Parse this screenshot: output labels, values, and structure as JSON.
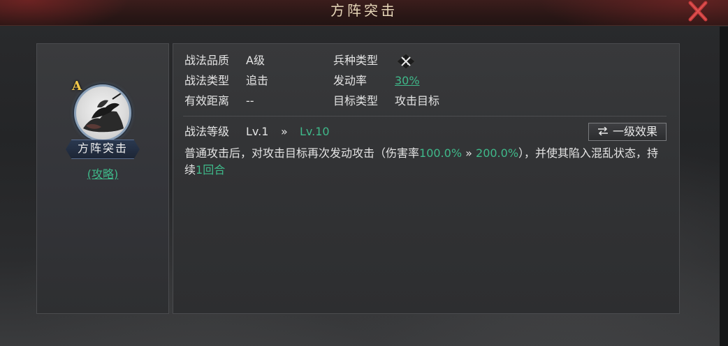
{
  "window": {
    "title": "方阵突击"
  },
  "colors": {
    "accent_green": "#3fb98a",
    "grade_gold": "#f2c84b",
    "close_red": "#c23a3a"
  },
  "skill": {
    "grade_badge": "A",
    "name": "方阵突击",
    "strategy_link": "(攻略)",
    "icon": "warrior-portrait"
  },
  "info": {
    "quality_label": "战法品质",
    "quality_value": "A级",
    "type_label": "战法类型",
    "type_value": "追击",
    "range_label": "有效距离",
    "range_value": "--",
    "unit_label": "兵种类型",
    "unit_icon": "crossed-weapons-icon",
    "rate_label": "发动率",
    "rate_value": "30%",
    "target_label": "目标类型",
    "target_value": "攻击目标"
  },
  "level": {
    "label": "战法等级",
    "from": "Lv.1",
    "arrow": "»",
    "to": "Lv.10",
    "effect_button": "一级效果",
    "effect_icon": "swap-arrows-icon"
  },
  "description": {
    "part1": "普通攻击后，对攻击目标再次发动攻击（伤害率",
    "dmg_from": "100.0%",
    "arrow": "»",
    "dmg_to": "200.0%",
    "part2": "），并使其陷入混乱状态，持续",
    "duration": "1回合"
  }
}
